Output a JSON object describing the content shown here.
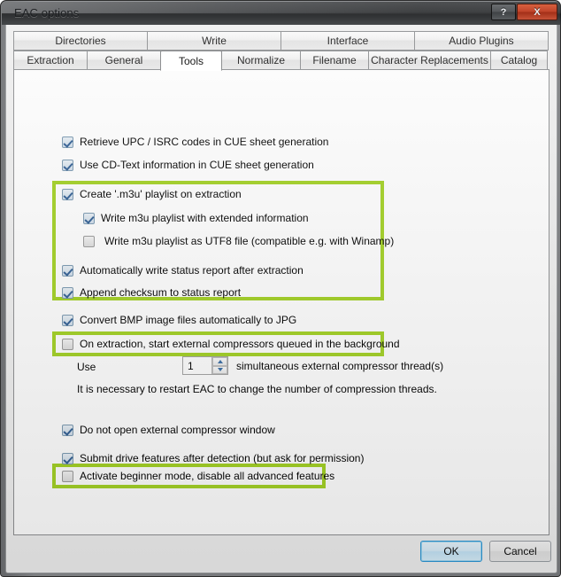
{
  "window": {
    "title": "EAC options",
    "help_button": "?",
    "close_button": "X"
  },
  "tabs": {
    "row1": [
      {
        "label": "Directories",
        "active": false
      },
      {
        "label": "Write",
        "active": false
      },
      {
        "label": "Interface",
        "active": false
      },
      {
        "label": "Audio Plugins",
        "active": false
      }
    ],
    "row2": [
      {
        "label": "Extraction",
        "active": false
      },
      {
        "label": "General",
        "active": false
      },
      {
        "label": "Tools",
        "active": true
      },
      {
        "label": "Normalize",
        "active": false
      },
      {
        "label": "Filename",
        "active": false
      },
      {
        "label": "Character Replacements",
        "active": false
      },
      {
        "label": "Catalog",
        "active": false
      }
    ]
  },
  "options": [
    {
      "label": "Retrieve UPC / ISRC codes in CUE sheet generation",
      "checked": true
    },
    {
      "label": "Use CD-Text information in CUE sheet generation",
      "checked": true
    },
    {
      "label": "Create '.m3u' playlist on extraction",
      "checked": true
    },
    {
      "label": "Write m3u playlist with extended information",
      "checked": true
    },
    {
      "label": "Write m3u playlist as UTF8 file (compatible e.g. with Winamp)",
      "checked": false
    },
    {
      "label": "Automatically write status report after extraction",
      "checked": true
    },
    {
      "label": "Append checksum to status report",
      "checked": true
    },
    {
      "label": "Convert BMP image files automatically to JPG",
      "checked": true
    },
    {
      "label": "On extraction, start external compressors queued in the background",
      "checked": false
    },
    {
      "label": "Do not open external compressor window",
      "checked": true
    },
    {
      "label": "Submit drive features after detection (but ask for permission)",
      "checked": true
    },
    {
      "label": "Activate beginner mode, disable all advanced features",
      "checked": false
    }
  ],
  "threads": {
    "use_label": "Use",
    "value": "1",
    "suffix_label": "simultaneous external compressor thread(s)",
    "note": "It is necessary to restart EAC to change the number of compression threads."
  },
  "buttons": {
    "ok": "OK",
    "cancel": "Cancel"
  },
  "highlight": {
    "color": "#a3d223"
  }
}
